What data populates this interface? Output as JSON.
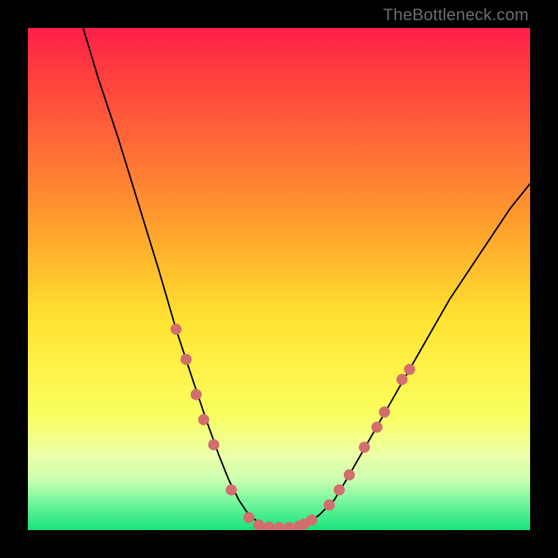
{
  "watermark": {
    "text": "TheBottleneck.com"
  },
  "chart_data": {
    "type": "line",
    "title": "",
    "xlabel": "",
    "ylabel": "",
    "xlim": [
      0,
      100
    ],
    "ylim": [
      0,
      100
    ],
    "series": [
      {
        "name": "curve",
        "color": "#000000",
        "x": [
          11,
          14,
          18,
          22,
          26,
          29.5,
          32.8,
          35.5,
          38,
          40,
          42,
          44,
          46,
          48,
          50,
          52,
          54,
          56,
          58,
          61,
          64,
          68,
          72,
          76,
          80,
          84,
          88,
          92,
          96,
          100
        ],
        "y": [
          100,
          90,
          78,
          65,
          52,
          40,
          30,
          22,
          15,
          10,
          6,
          3,
          1.5,
          0.8,
          0.5,
          0.5,
          0.8,
          1.5,
          3,
          6,
          11,
          18,
          25,
          32,
          39,
          46,
          52,
          58,
          64,
          69
        ]
      }
    ],
    "markers": [
      {
        "x": 29.5,
        "y": 40
      },
      {
        "x": 31.5,
        "y": 34
      },
      {
        "x": 33.5,
        "y": 27
      },
      {
        "x": 35.0,
        "y": 22
      },
      {
        "x": 37.0,
        "y": 17
      },
      {
        "x": 40.5,
        "y": 8
      },
      {
        "x": 44.0,
        "y": 2.5
      },
      {
        "x": 46.0,
        "y": 1.0
      },
      {
        "x": 48.0,
        "y": 0.6
      },
      {
        "x": 50.0,
        "y": 0.5
      },
      {
        "x": 52.0,
        "y": 0.5
      },
      {
        "x": 54.0,
        "y": 0.8
      },
      {
        "x": 55.0,
        "y": 1.2
      },
      {
        "x": 56.5,
        "y": 2.0
      },
      {
        "x": 60.0,
        "y": 5.0
      },
      {
        "x": 62.0,
        "y": 8.0
      },
      {
        "x": 64.0,
        "y": 11.0
      },
      {
        "x": 67.0,
        "y": 16.5
      },
      {
        "x": 69.5,
        "y": 20.5
      },
      {
        "x": 71.0,
        "y": 23.5
      },
      {
        "x": 74.5,
        "y": 30.0
      },
      {
        "x": 76.0,
        "y": 32.0
      }
    ],
    "marker_style": {
      "color": "#d36e6e",
      "radius_px": 8
    }
  }
}
